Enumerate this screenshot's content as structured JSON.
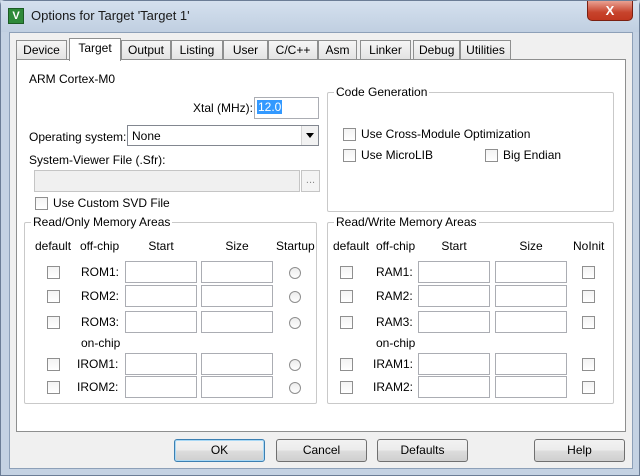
{
  "window": {
    "title": "Options for Target 'Target 1'",
    "close_glyph": "X",
    "app_icon_letter": "V"
  },
  "tabs": [
    {
      "label": "Device"
    },
    {
      "label": "Target"
    },
    {
      "label": "Output"
    },
    {
      "label": "Listing"
    },
    {
      "label": "User"
    },
    {
      "label": "C/C++"
    },
    {
      "label": "Asm"
    },
    {
      "label": "Linker"
    },
    {
      "label": "Debug"
    },
    {
      "label": "Utilities"
    }
  ],
  "target": {
    "device_name": "ARM Cortex-M0",
    "xtal_label": "Xtal (MHz):",
    "xtal_value": "12.0",
    "os_label": "Operating system:",
    "os_value": "None",
    "sfr_label": "System-Viewer File (.Sfr):",
    "sfr_value": "",
    "browse_label": "...",
    "custom_svd_label": "Use Custom SVD File"
  },
  "code_generation": {
    "title": "Code Generation",
    "cross_module_label": "Use Cross-Module Optimization",
    "microlib_label": "Use MicroLIB",
    "big_endian_label": "Big Endian"
  },
  "ro_memory": {
    "title": "Read/Only Memory Areas",
    "headers": {
      "default": "default",
      "offchip": "off-chip",
      "start": "Start",
      "size": "Size",
      "startup": "Startup"
    },
    "onchip_label": "on-chip",
    "rows": [
      {
        "label": "ROM1:",
        "start": "",
        "size": ""
      },
      {
        "label": "ROM2:",
        "start": "",
        "size": ""
      },
      {
        "label": "ROM3:",
        "start": "",
        "size": ""
      },
      {
        "label": "IROM1:",
        "start": "",
        "size": ""
      },
      {
        "label": "IROM2:",
        "start": "",
        "size": ""
      }
    ]
  },
  "rw_memory": {
    "title": "Read/Write Memory Areas",
    "headers": {
      "default": "default",
      "offchip": "off-chip",
      "start": "Start",
      "size": "Size",
      "noinit": "NoInit"
    },
    "onchip_label": "on-chip",
    "rows": [
      {
        "label": "RAM1:",
        "start": "",
        "size": ""
      },
      {
        "label": "RAM2:",
        "start": "",
        "size": ""
      },
      {
        "label": "RAM3:",
        "start": "",
        "size": ""
      },
      {
        "label": "IRAM1:",
        "start": "",
        "size": ""
      },
      {
        "label": "IRAM2:",
        "start": "",
        "size": ""
      }
    ]
  },
  "buttons": {
    "ok": "OK",
    "cancel": "Cancel",
    "defaults": "Defaults",
    "help": "Help"
  },
  "colors": {
    "selection": "#3399ff",
    "close_button": "#c7432c",
    "frame": "#c4d2e3"
  }
}
